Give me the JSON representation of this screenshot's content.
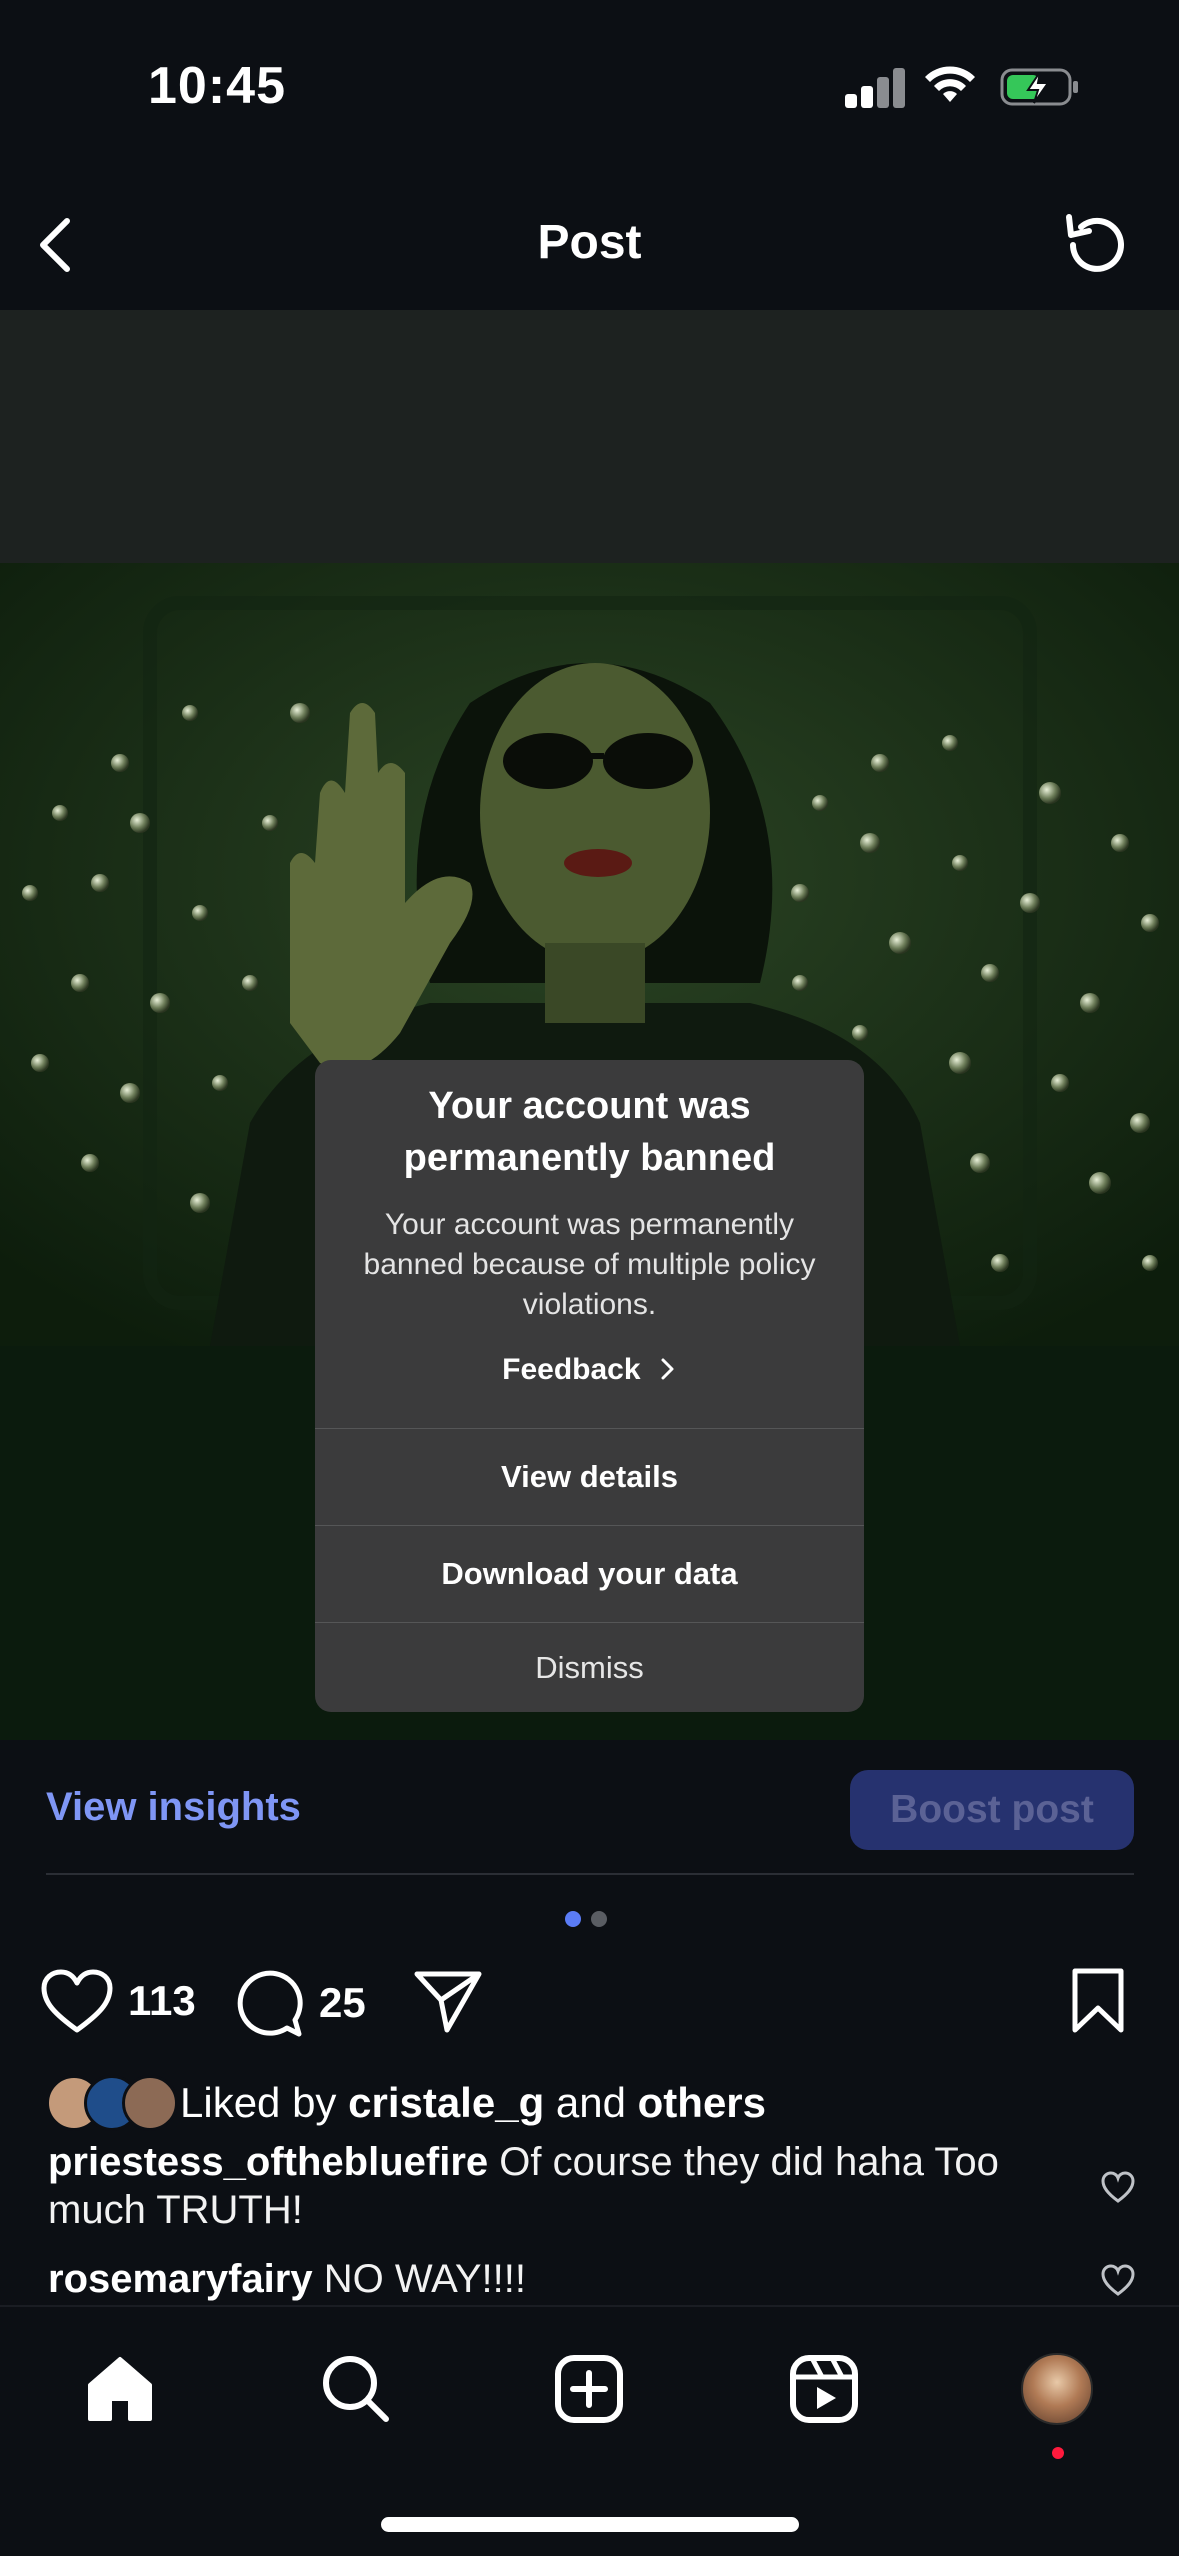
{
  "status_bar": {
    "time": "10:45"
  },
  "header": {
    "title": "Post"
  },
  "modal": {
    "title": "Your account was permanently banned",
    "body": "Your account was permanently banned because of multiple policy violations.",
    "feedback": "Feedback",
    "actions": [
      "View details",
      "Download your data",
      "Dismiss"
    ]
  },
  "insights": {
    "view_label": "View insights",
    "boost_label": "Boost post"
  },
  "post_actions": {
    "likes": "113",
    "comments": "25"
  },
  "liked_by": {
    "prefix": "Liked by",
    "user": "cristale_g",
    "conj": "and",
    "others": "others"
  },
  "comments": [
    {
      "user": "priestess_oftheblue­fire",
      "text": "Of course they did haha Too much TRUTH!"
    },
    {
      "user": "rosemaryfairy",
      "text": "NO WAY!!!!"
    }
  ],
  "colors": {
    "accent": "#7f96f5",
    "boost_bg": "#26326f",
    "modal_bg": "#3b3b3c",
    "notification_dot": "#ff1a3d"
  },
  "icons": [
    "back-chevron-icon",
    "refresh-icon",
    "heart-icon",
    "comment-icon",
    "share-icon",
    "bookmark-icon",
    "home-icon",
    "search-icon",
    "create-icon",
    "reels-icon",
    "profile-avatar"
  ]
}
